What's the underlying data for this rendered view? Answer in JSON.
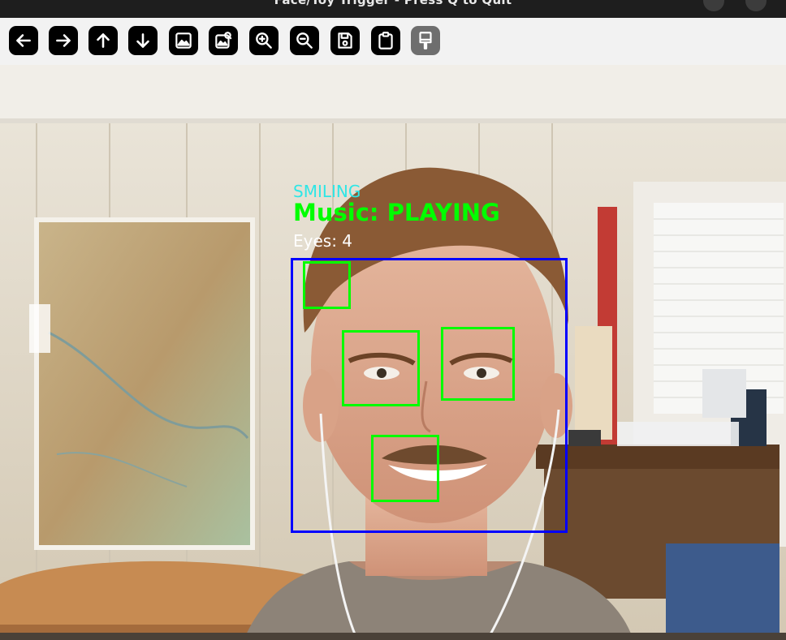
{
  "window": {
    "title": "Face/Toy Trigger - Press Q to Quit"
  },
  "toolbar": {
    "tools": [
      {
        "name": "pan-left-button",
        "icon": "arrow-left-icon"
      },
      {
        "name": "pan-right-button",
        "icon": "arrow-right-icon"
      },
      {
        "name": "pan-up-button",
        "icon": "arrow-up-icon"
      },
      {
        "name": "pan-down-button",
        "icon": "arrow-down-icon"
      },
      {
        "name": "zoom-fit-button",
        "icon": "image-icon"
      },
      {
        "name": "zoom-original-button",
        "icon": "image-search-icon"
      },
      {
        "name": "zoom-in-button",
        "icon": "zoom-in-icon"
      },
      {
        "name": "zoom-out-button",
        "icon": "zoom-out-icon"
      },
      {
        "name": "save-button",
        "icon": "save-icon"
      },
      {
        "name": "copy-clipboard-button",
        "icon": "clipboard-icon"
      },
      {
        "name": "properties-button",
        "icon": "paint-brush-icon"
      }
    ]
  },
  "overlay": {
    "smile_label": "SMILING",
    "music_label": "Music: PLAYING",
    "eyes_label": "Eyes: 4"
  },
  "colors": {
    "smile_text": "#2ee6e6",
    "music_text": "#00ff00",
    "eyes_text": "#ffffff",
    "face_box": "#0000ff",
    "feature_box": "#00ff00"
  }
}
